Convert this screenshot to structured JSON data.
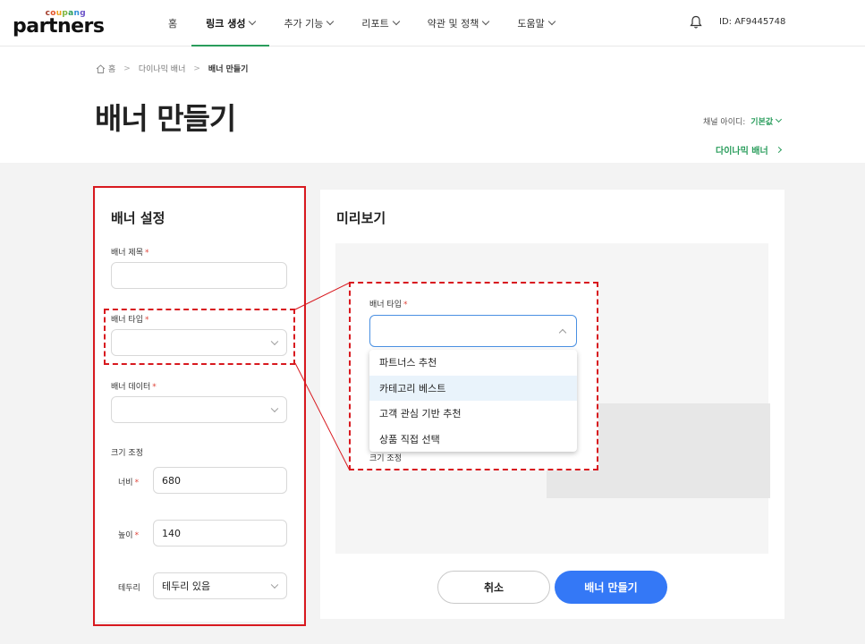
{
  "header": {
    "logo_top": "coupang",
    "logo_main": "partners",
    "nav": [
      {
        "label": "홈",
        "dropdown": false,
        "active": false
      },
      {
        "label": "링크 생성",
        "dropdown": true,
        "active": true
      },
      {
        "label": "추가 기능",
        "dropdown": true,
        "active": false
      },
      {
        "label": "리포트",
        "dropdown": true,
        "active": false
      },
      {
        "label": "약관 및 정책",
        "dropdown": true,
        "active": false
      },
      {
        "label": "도움말",
        "dropdown": true,
        "active": false
      }
    ],
    "user_id": "ID: AF9445748",
    "accent_color": "#2a9d5c"
  },
  "breadcrumb": {
    "home": "홈",
    "level1": "다이나믹 배너",
    "current": "배너 만들기"
  },
  "page_title": "배너 만들기",
  "channel": {
    "label": "채널 아이디:",
    "value": "기본값"
  },
  "dynamic_banner_link": "다이나믹 배너",
  "settings": {
    "title": "배너 설정",
    "banner_title_label": "배너 제목",
    "banner_title_value": "",
    "banner_type_label": "배너 타입",
    "banner_type_value": "",
    "banner_data_label": "배너 데이터",
    "banner_data_value": "",
    "size_label": "크기 조정",
    "width_label": "너비",
    "width_value": "680",
    "height_label": "높이",
    "height_value": "140",
    "border_label": "테두리",
    "border_value": "테두리 있음",
    "required_mark": "*"
  },
  "preview": {
    "title": "미리보기"
  },
  "callout": {
    "label": "배너 타입",
    "options": [
      "파트너스 추천",
      "카테고리 베스트",
      "고객 관심 기반 추천",
      "상품 직접 선택"
    ],
    "highlighted_index": 1,
    "size_label": "크기 조정"
  },
  "buttons": {
    "cancel": "취소",
    "create": "배너 만들기",
    "primary_color": "#3478f6"
  }
}
